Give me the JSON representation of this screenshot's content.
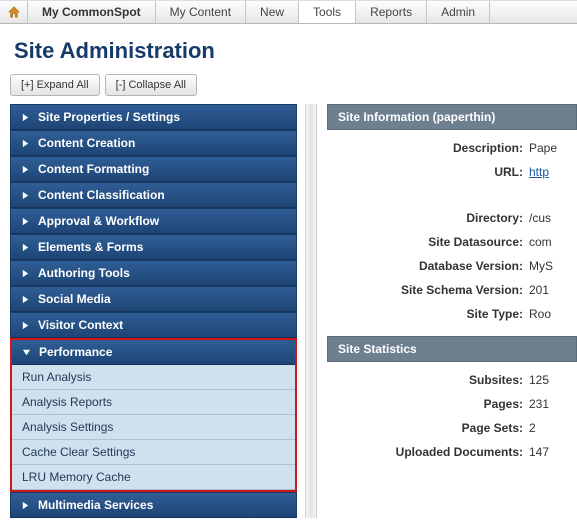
{
  "topnav": {
    "items": [
      {
        "label": "My CommonSpot",
        "current": true
      },
      {
        "label": "My Content"
      },
      {
        "label": "New"
      },
      {
        "label": "Tools",
        "active": true
      },
      {
        "label": "Reports"
      },
      {
        "label": "Admin"
      }
    ]
  },
  "page_title": "Site Administration",
  "toolbar": {
    "expand_all": "[+] Expand All",
    "collapse_all": "[-] Collapse All"
  },
  "sidebar": {
    "items": [
      {
        "label": "Site Properties / Settings"
      },
      {
        "label": "Content Creation"
      },
      {
        "label": "Content Formatting"
      },
      {
        "label": "Content Classification"
      },
      {
        "label": "Approval & Workflow"
      },
      {
        "label": "Elements & Forms"
      },
      {
        "label": "Authoring Tools"
      },
      {
        "label": "Social Media"
      },
      {
        "label": "Visitor Context"
      }
    ],
    "performance": {
      "label": "Performance",
      "children": [
        "Run Analysis",
        "Analysis Reports",
        "Analysis Settings",
        "Cache Clear Settings",
        "LRU Memory Cache"
      ]
    },
    "after": [
      {
        "label": "Multimedia Services"
      }
    ]
  },
  "info_panel": {
    "title": "Site Information (paperthin)",
    "rows": [
      {
        "label": "Description:",
        "value": "Pape"
      },
      {
        "label": "URL:",
        "value": "http",
        "link": true
      },
      {
        "label": "Directory:",
        "value": "/cus",
        "gap_before": true
      },
      {
        "label": "Site Datasource:",
        "value": "com"
      },
      {
        "label": "Database Version:",
        "value": "MyS"
      },
      {
        "label": "Site Schema Version:",
        "value": "201"
      },
      {
        "label": "Site Type:",
        "value": "Roo"
      }
    ]
  },
  "stats_panel": {
    "title": "Site Statistics",
    "rows": [
      {
        "label": "Subsites:",
        "value": "125"
      },
      {
        "label": "Pages:",
        "value": "231"
      },
      {
        "label": "Page Sets:",
        "value": "2"
      },
      {
        "label": "Uploaded Documents:",
        "value": "147"
      }
    ]
  }
}
